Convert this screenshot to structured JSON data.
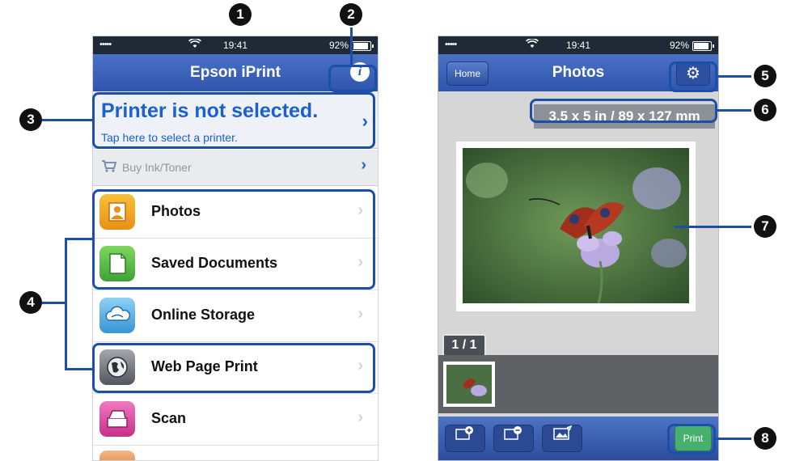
{
  "colors": {
    "accent": "#1b4fa8",
    "nav": "#2f54ad",
    "link": "#1b5fd1",
    "print": "#46b06d"
  },
  "left_phone": {
    "status": {
      "dots": "•••••",
      "time": "19:41",
      "battery": "92%"
    },
    "title": "Epson iPrint",
    "info_icon": "info-icon",
    "printer_select": {
      "main": "Printer is not selected.",
      "sub": "Tap here to select a printer.",
      "chevron": "›"
    },
    "buy": {
      "label": "Buy Ink/Toner",
      "chevron": "›"
    },
    "menu": [
      {
        "label": "Photos",
        "icon": "photos-icon",
        "color": "#f0a821"
      },
      {
        "label": "Saved Documents",
        "icon": "document-icon",
        "color": "#62c24a"
      },
      {
        "label": "Online Storage",
        "icon": "cloud-icon",
        "color": "#4aa4e0"
      },
      {
        "label": "Web Page Print",
        "icon": "globe-icon",
        "color": "#6e737a"
      },
      {
        "label": "Scan",
        "icon": "scanner-icon",
        "color": "#d6399a"
      }
    ],
    "chevron": "›"
  },
  "right_phone": {
    "status": {
      "dots": "•••••",
      "time": "19:41",
      "battery": "92%"
    },
    "home_label": "Home",
    "title": "Photos",
    "settings_icon": "gear-icon",
    "paper_size": "3.5 x 5 in / 89 x 127 mm",
    "page_count": "1 / 1",
    "toolbar": {
      "zoom_in_icon": "zoom-in-icon",
      "zoom_out_icon": "zoom-out-icon",
      "edit_icon": "edit-image-icon",
      "print_label": "Print"
    }
  },
  "callouts": [
    "1",
    "2",
    "3",
    "4",
    "5",
    "6",
    "7",
    "8"
  ]
}
